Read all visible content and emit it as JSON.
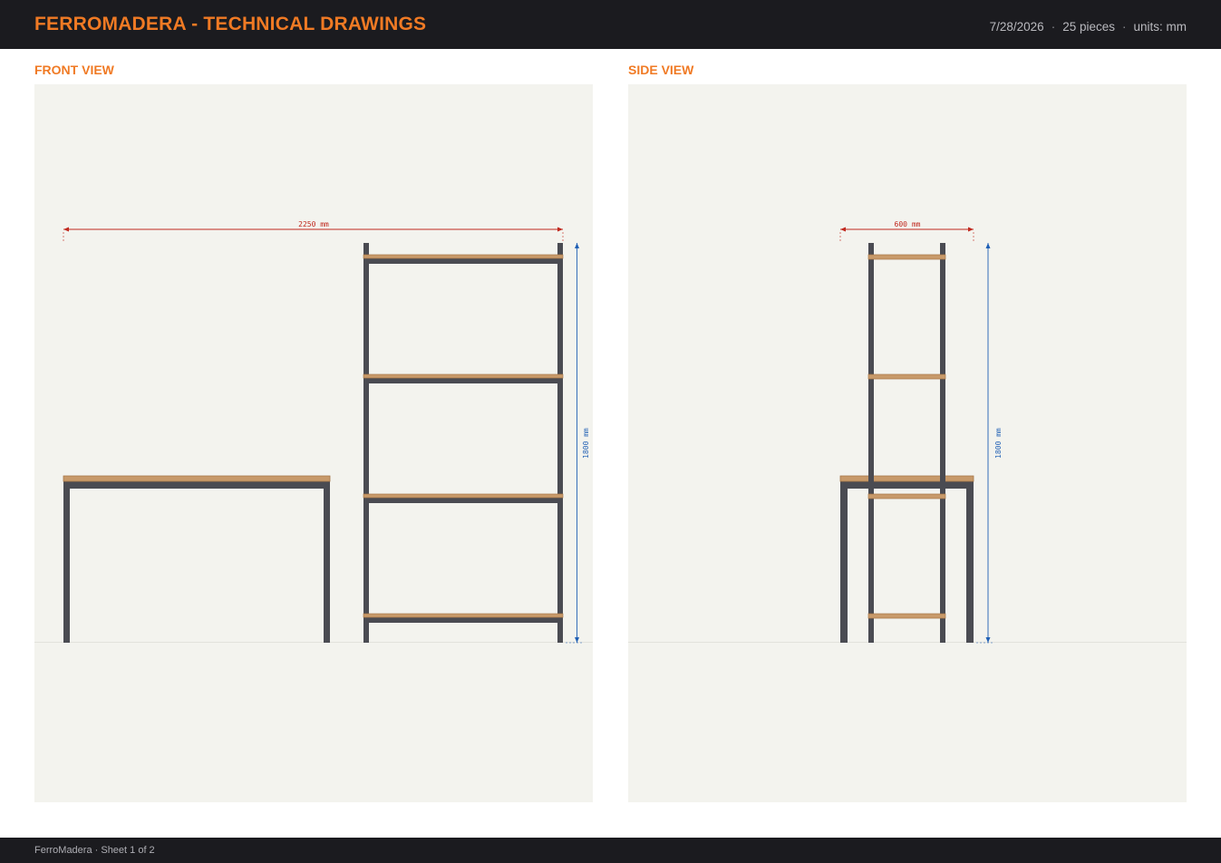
{
  "header": {
    "title": "FERROMADERA - TECHNICAL DRAWINGS",
    "date": "7/28/2026",
    "separator": "·",
    "pieces": "25 pieces",
    "units": "units: mm"
  },
  "views": {
    "front": {
      "label": "FRONT VIEW",
      "width_dim": "2250 mm",
      "height_dim": "1800 mm"
    },
    "side": {
      "label": "SIDE VIEW",
      "width_dim": "600 mm",
      "height_dim": "1800 mm"
    }
  },
  "footer": {
    "text": "FerroMadera · Sheet 1 of 2"
  },
  "colors": {
    "steel": "#4a4b52",
    "wood": "#c89a6a",
    "wood_edge": "#a57648",
    "width_dim": "#c0281e",
    "height_dim": "#1f5fb4",
    "accent": "#f07a24"
  }
}
